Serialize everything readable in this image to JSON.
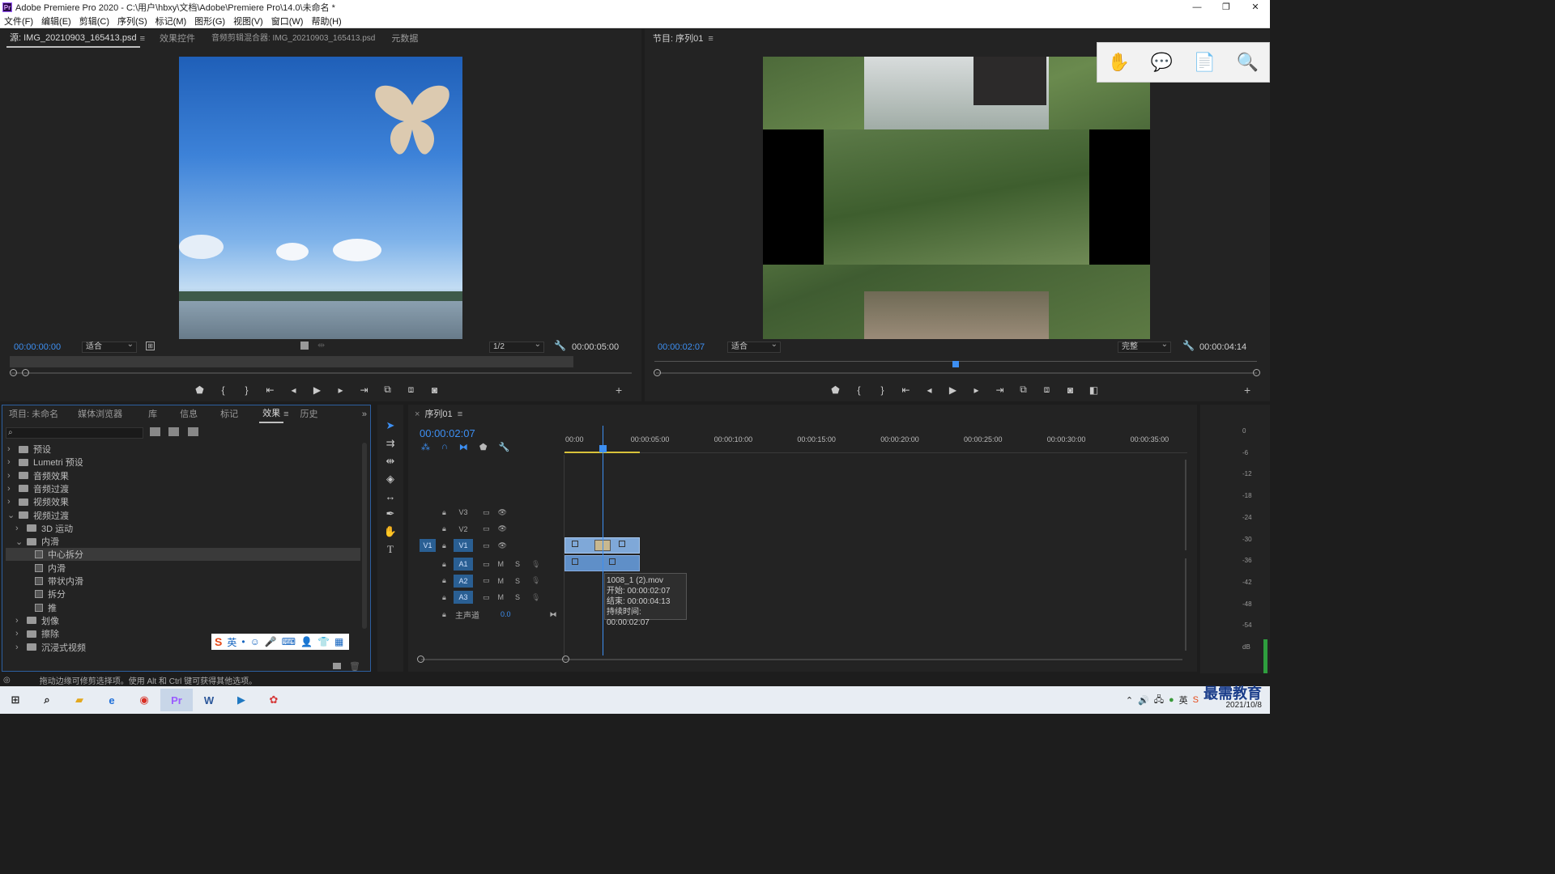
{
  "window": {
    "title": "Adobe Premiere Pro 2020 - C:\\用户\\hbxy\\文档\\Adobe\\Premiere Pro\\14.0\\未命名 *",
    "logo": "Pr",
    "controls": [
      "—",
      "❐",
      "✕"
    ]
  },
  "menu": [
    "文件(F)",
    "编辑(E)",
    "剪辑(C)",
    "序列(S)",
    "标记(M)",
    "图形(G)",
    "视图(V)",
    "窗口(W)",
    "帮助(H)"
  ],
  "source": {
    "tabs": [
      "源: IMG_20210903_165413.psd",
      "效果控件",
      "音频剪辑混合器: IMG_20210903_165413.psd",
      "元数据"
    ],
    "timecode": "00:00:00:00",
    "fit": "适合",
    "resolution": "1/2",
    "duration": "00:00:05:00"
  },
  "program": {
    "tab": "节目: 序列01",
    "timecode": "00:00:02:07",
    "fit": "适合",
    "quality": "完整",
    "duration": "00:00:04:14"
  },
  "project": {
    "tabs": [
      "项目: 未命名",
      "媒体浏览器",
      "库",
      "信息",
      "标记",
      "效果",
      "历史"
    ],
    "tree": [
      {
        "label": "预设",
        "type": "folder",
        "level": 0,
        "arrow": "›"
      },
      {
        "label": "Lumetri 预设",
        "type": "folder",
        "level": 0,
        "arrow": "›"
      },
      {
        "label": "音频效果",
        "type": "folder",
        "level": 0,
        "arrow": "›"
      },
      {
        "label": "音频过渡",
        "type": "folder",
        "level": 0,
        "arrow": "›"
      },
      {
        "label": "视频效果",
        "type": "folder",
        "level": 0,
        "arrow": "›"
      },
      {
        "label": "视频过渡",
        "type": "folder",
        "level": 0,
        "arrow": "⌄"
      },
      {
        "label": "3D 运动",
        "type": "folder",
        "level": 1,
        "arrow": "›"
      },
      {
        "label": "内滑",
        "type": "folder",
        "level": 1,
        "arrow": "⌄"
      },
      {
        "label": "中心拆分",
        "type": "fx",
        "level": 2,
        "arrow": "",
        "selected": true
      },
      {
        "label": "内滑",
        "type": "fx",
        "level": 2,
        "arrow": ""
      },
      {
        "label": "带状内滑",
        "type": "fx",
        "level": 2,
        "arrow": ""
      },
      {
        "label": "拆分",
        "type": "fx",
        "level": 2,
        "arrow": ""
      },
      {
        "label": "推",
        "type": "fx",
        "level": 2,
        "arrow": ""
      },
      {
        "label": "划像",
        "type": "folder",
        "level": 1,
        "arrow": "›"
      },
      {
        "label": "擦除",
        "type": "folder",
        "level": 1,
        "arrow": "›"
      },
      {
        "label": "沉浸式视频",
        "type": "folder",
        "level": 1,
        "arrow": "›"
      }
    ],
    "ime": {
      "label": "英"
    }
  },
  "timeline": {
    "tab": "序列01",
    "timecode": "00:00:02:07",
    "ruler": [
      "00:00",
      "00:00:05:00",
      "00:00:10:00",
      "00:00:15:00",
      "00:00:20:00",
      "00:00:25:00",
      "00:00:30:00",
      "00:00:35:00"
    ],
    "video_tracks": [
      "V3",
      "V2",
      "V1"
    ],
    "audio_tracks": [
      "A1",
      "A2",
      "A3"
    ],
    "source_patch": "V1",
    "master_label": "主声道",
    "master_value": "0.0",
    "mute": "M",
    "solo": "S",
    "tooltip": [
      "1008_1 (2).mov",
      "开始: 00:00:02:07",
      "结束: 00:00:04:13",
      "持续时间: 00:00:02:07"
    ]
  },
  "meter": [
    "0",
    "-6",
    "-12",
    "-18",
    "-24",
    "-30",
    "-36",
    "-42",
    "-48",
    "-54",
    "dB"
  ],
  "status": "拖动边缘可修剪选择项。使用 Alt 和 Ctrl 键可获得其他选项。",
  "taskbar": {
    "date": "2021/10/8",
    "watermark": "最需教育",
    "tray": [
      "英"
    ]
  }
}
